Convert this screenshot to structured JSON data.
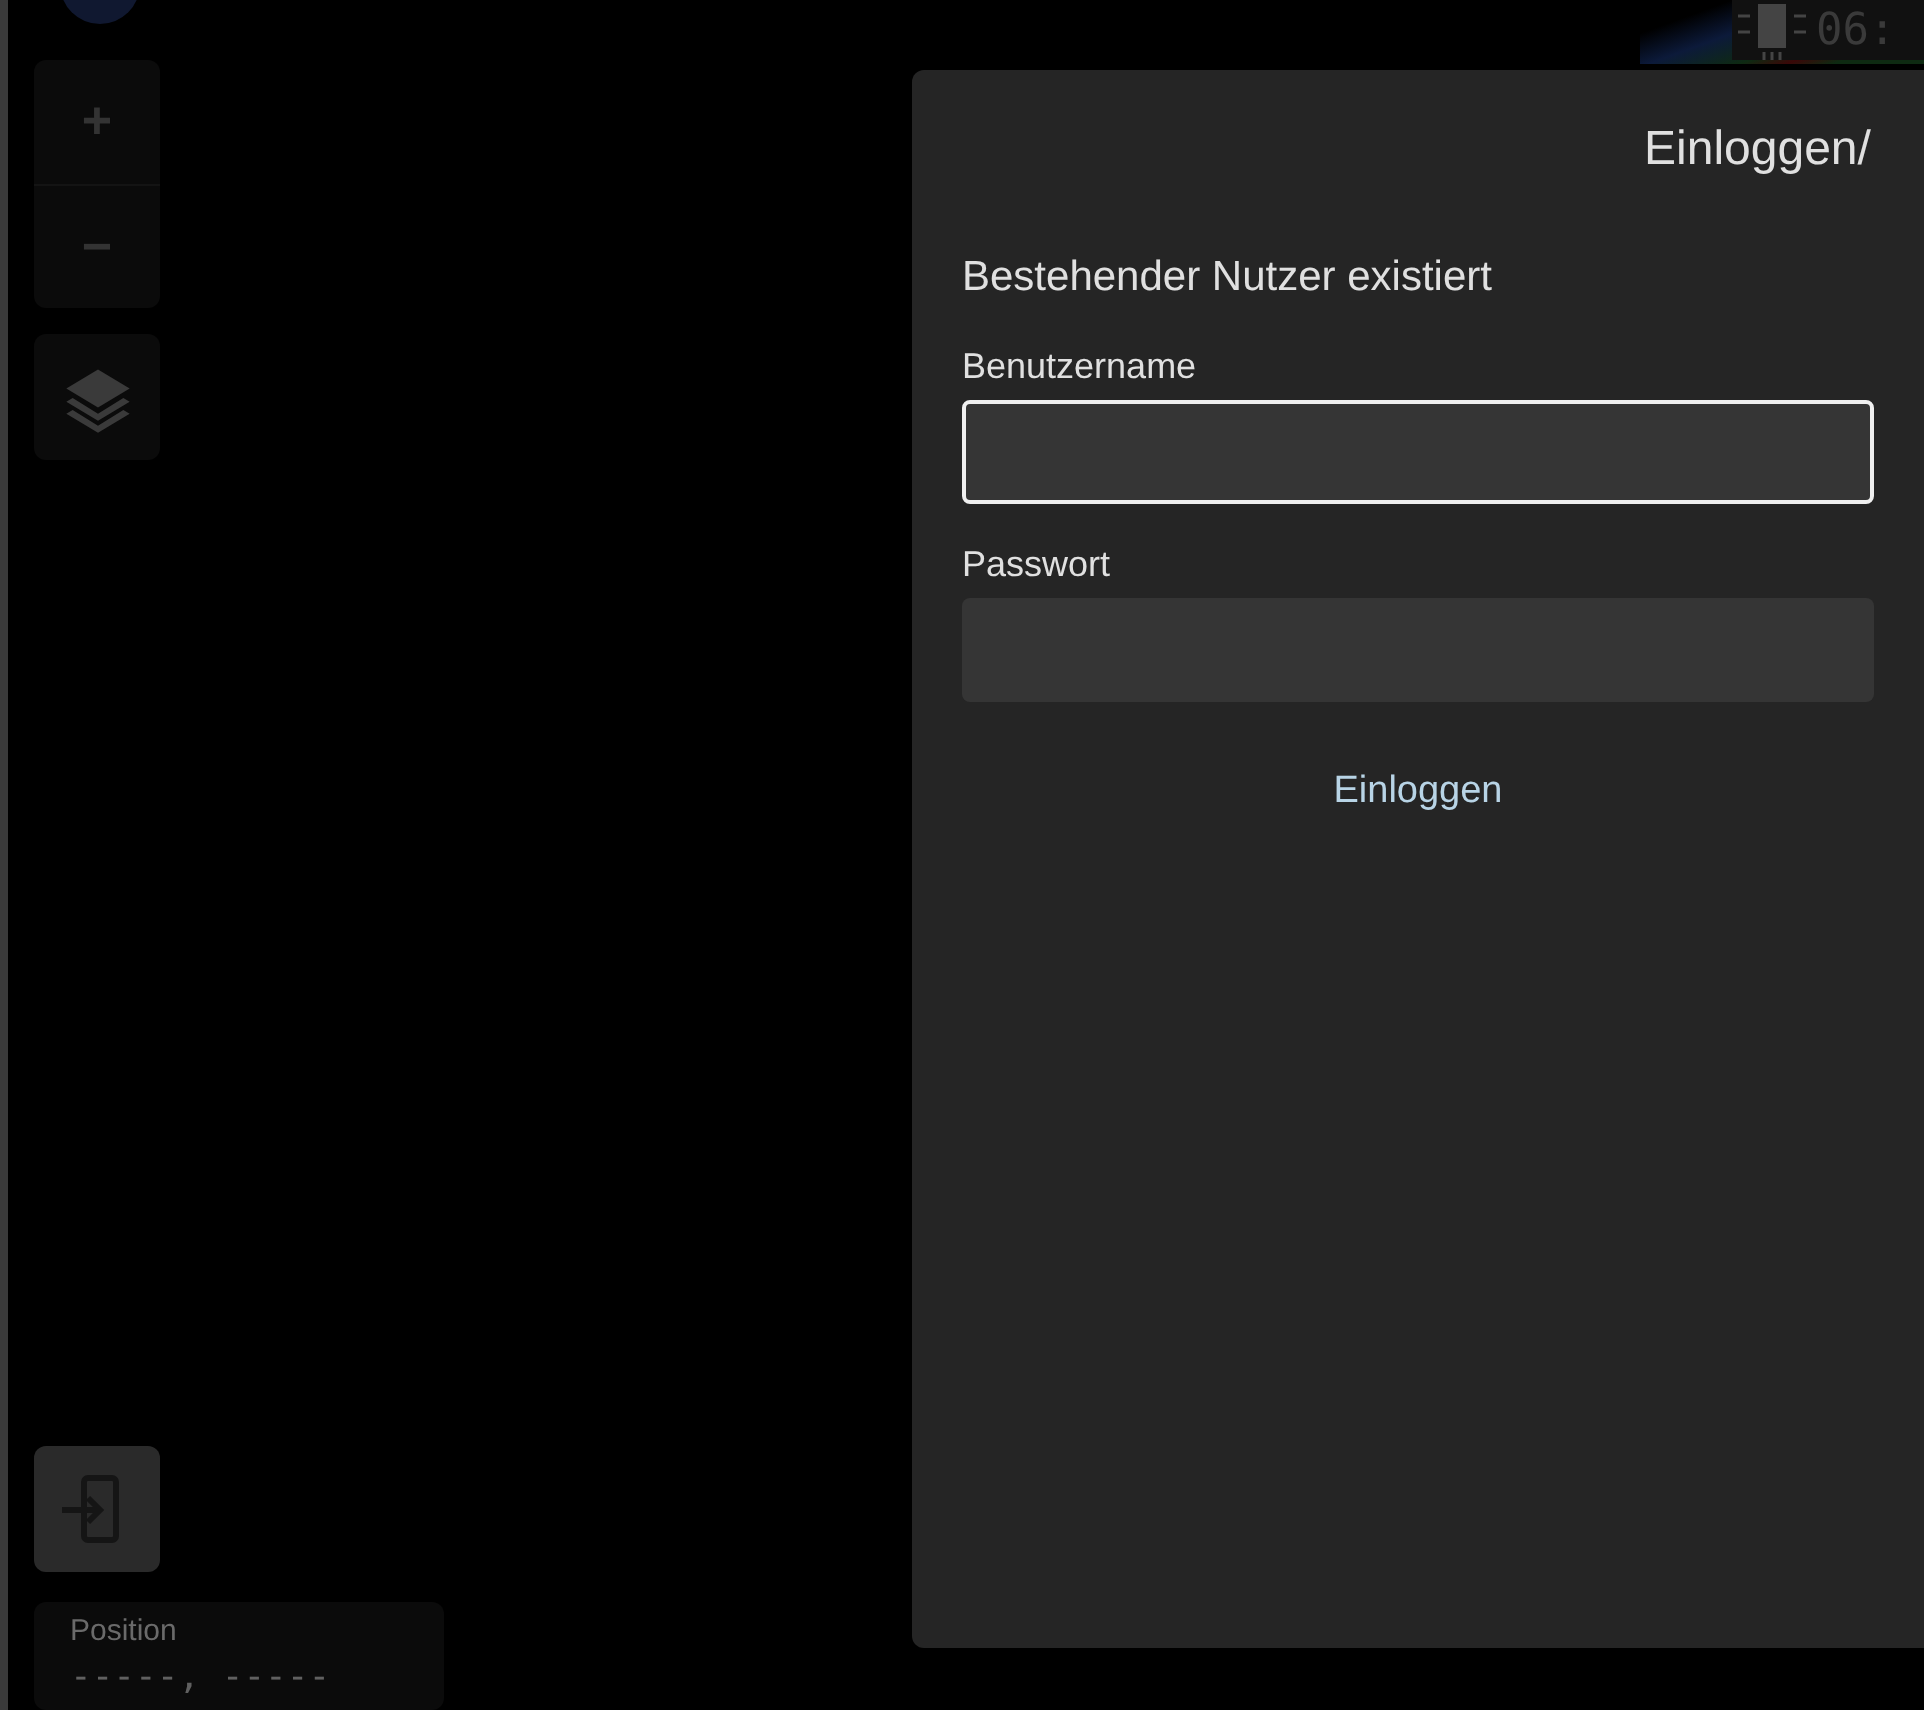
{
  "map_controls": {
    "zoom_in": "+",
    "zoom_out": "−"
  },
  "clock": {
    "time": "06:"
  },
  "dialog": {
    "title": "Einloggen/",
    "heading": "Bestehender Nutzer existiert",
    "fields": [
      {
        "label": "Benutzername",
        "focused": true
      },
      {
        "label": "Passwort",
        "focused": false
      }
    ],
    "submit": "Einloggen"
  },
  "position": {
    "label": "Position",
    "value": "-----, -----"
  }
}
